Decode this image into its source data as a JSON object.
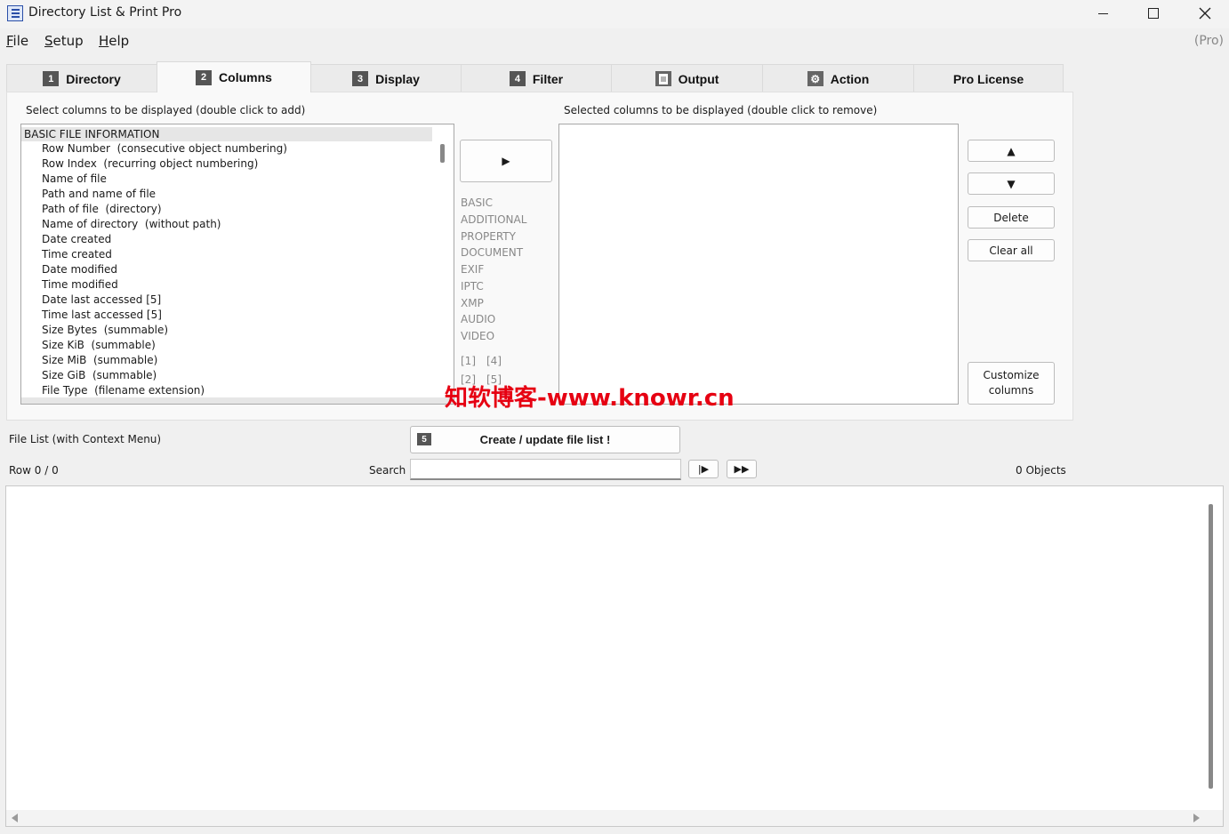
{
  "window": {
    "title": "Directory List & Print Pro",
    "edition": "(Pro)"
  },
  "menu": [
    "File",
    "Setup",
    "Help"
  ],
  "tabs": [
    {
      "num": "1",
      "label": "Directory"
    },
    {
      "num": "2",
      "label": "Columns"
    },
    {
      "num": "3",
      "label": "Display"
    },
    {
      "num": "4",
      "label": "Filter"
    },
    {
      "icon": "document-icon",
      "label": "Output"
    },
    {
      "icon": "gear-icon",
      "label": "Action"
    },
    {
      "label": "Pro License"
    }
  ],
  "active_tab": "Columns",
  "columns_panel": {
    "available_label": "Select columns to be displayed (double click to add)",
    "selected_label": "Selected columns to be displayed (double click to remove)",
    "group_header": "BASIC FILE INFORMATION",
    "available_items": [
      "Row Number  (consecutive object numbering)",
      "Row Index  (recurring object numbering)",
      "Name of file",
      "Path and name of file",
      "Path of file  (directory)",
      "Name of directory  (without path)",
      "Date created",
      "Time created",
      "Date modified",
      "Time modified",
      "Date last accessed [5]",
      "Time last accessed [5]",
      "Size Bytes  (summable)",
      "Size KiB  (summable)",
      "Size MiB  (summable)",
      "Size GiB  (summable)",
      "File Type  (filename extension)"
    ],
    "add_button": "▶",
    "categories": [
      "BASIC",
      "ADDITIONAL",
      "PROPERTY",
      "DOCUMENT",
      "EXIF",
      "IPTC",
      "XMP",
      "AUDIO",
      "VIDEO"
    ],
    "footnotes_row1": [
      "[1]",
      "[4]"
    ],
    "footnotes_row2": [
      "[2]",
      "[5]"
    ],
    "move_up_button": "▲",
    "move_down_button": "▼",
    "delete_button": "Delete",
    "clear_all_button": "Clear all",
    "customize_button": "Customize columns",
    "selected_items": []
  },
  "watermark": "知软博客-www.knowr.cn",
  "file_list": {
    "label": "File List (with Context Menu)",
    "create_num": "5",
    "create_button": "Create / update file list !",
    "row_status": "Row 0 / 0",
    "search_label": "Search",
    "search_value": "",
    "find_next_button": "|▶",
    "find_all_button": "▶▶",
    "objects_count": "0 Objects"
  }
}
